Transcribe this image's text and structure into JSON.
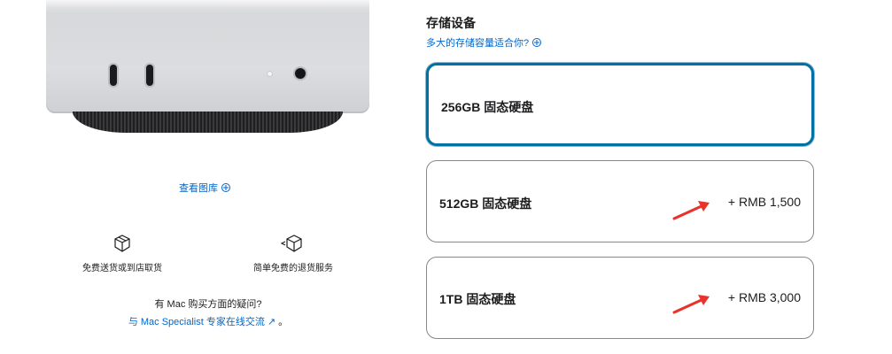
{
  "product": {
    "gallery_link": "查看图库",
    "features": [
      {
        "icon": "box-icon",
        "label": "免费送货或到店取货"
      },
      {
        "icon": "return-box-icon",
        "label": "简单免费的退货服务"
      }
    ],
    "help_question": "有 Mac 购买方面的疑问?",
    "help_link": "与 Mac Specialist 专家在线交流 ↗",
    "help_link_suffix": " 。"
  },
  "storage": {
    "title": "存储设备",
    "help": "多大的存储容量适合你?",
    "options": [
      {
        "label": "256GB 固态硬盘",
        "price": "",
        "selected": true
      },
      {
        "label": "512GB 固态硬盘",
        "price": "+ RMB 1,500",
        "selected": false
      },
      {
        "label": "1TB 固态硬盘",
        "price": "+ RMB 3,000",
        "selected": false
      }
    ]
  },
  "colors": {
    "accent": "#0066cc",
    "selected_border": "#0071a4",
    "annotation_arrow": "#e8322a"
  }
}
